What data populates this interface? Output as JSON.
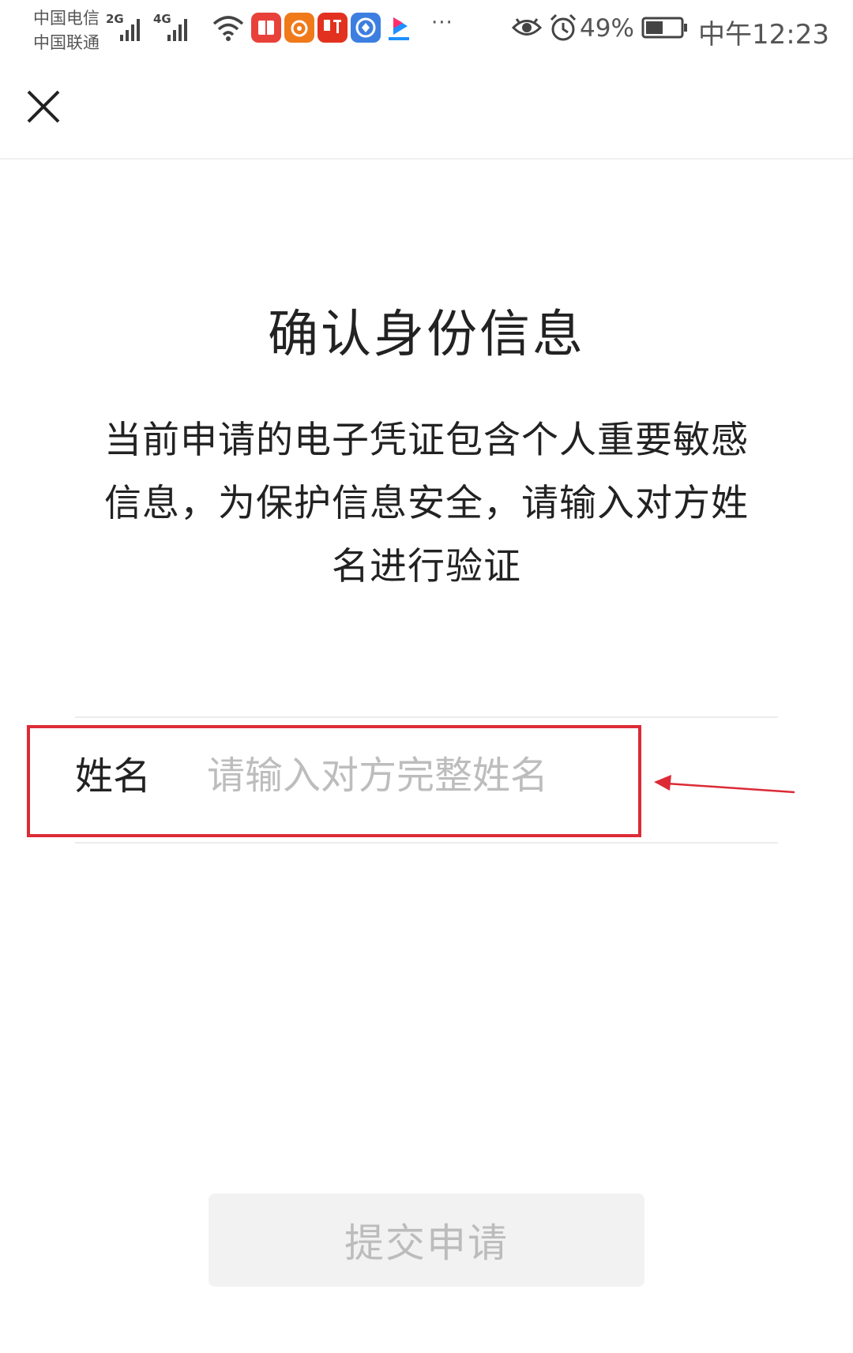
{
  "status_bar": {
    "carrier_1": "中国电信",
    "carrier_2": "中国联通",
    "signal_1_tag": "2G",
    "signal_2_tag": "4G",
    "app_icons": [
      "reader-app-icon",
      "uc-browser-icon",
      "ting-audio-icon",
      "browser-app-icon",
      "youku-icon"
    ],
    "more_label": "···",
    "battery_percent": "49%",
    "battery_level": 0.49,
    "time": "中午12:23"
  },
  "header": {
    "close_icon": "close-icon"
  },
  "main": {
    "title": "确认身份信息",
    "description_lines": [
      "当前申请的电子凭证包含个人重要敏感",
      "信息，为保护信息安全，请输入对方姓",
      "名进行验证"
    ],
    "name_field": {
      "label": "姓名",
      "placeholder": "请输入对方完整姓名",
      "value": ""
    },
    "submit_label": "提交申请"
  },
  "colors": {
    "highlight": "#dc2b36",
    "button_bg": "#f2f2f2",
    "button_text": "#bcbcbc",
    "placeholder": "#bdbdbd"
  }
}
